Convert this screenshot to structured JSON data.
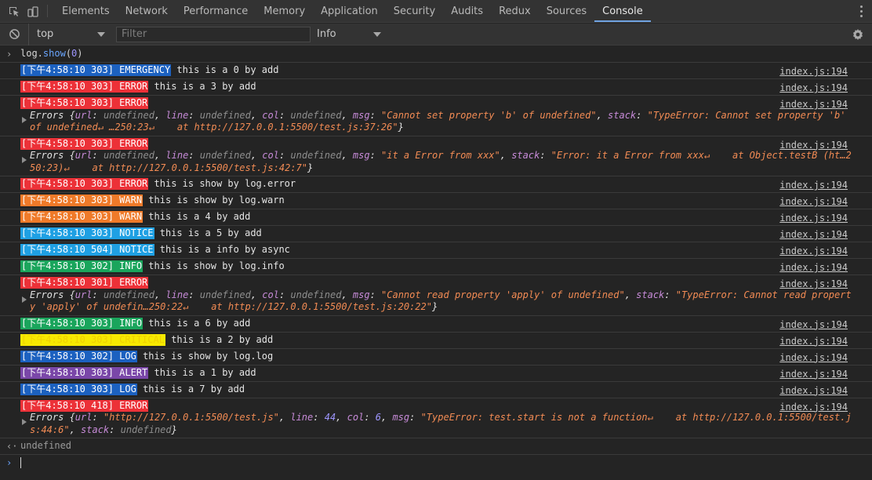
{
  "tabs": [
    "Elements",
    "Network",
    "Performance",
    "Memory",
    "Application",
    "Security",
    "Audits",
    "Redux",
    "Sources",
    "Console"
  ],
  "active_tab": "Console",
  "toolbar": {
    "context": "top",
    "filter_placeholder": "Filter",
    "level": "Info"
  },
  "input_command": {
    "prefix": "log.",
    "method": "show",
    "open": "(",
    "arg": "0",
    "close": ")"
  },
  "colors": {
    "EMERGENCY": "#1c61c0",
    "ERROR": "#ec3138",
    "WARN": "#ef7a29",
    "NOTICE": "#1fa0e3",
    "INFO": "#1aa55c",
    "CRITICAL": "#f7e900",
    "LOG": "#1c61c0",
    "ALERT": "#7a47a8"
  },
  "source": "index.js:194",
  "messages": [
    {
      "tag": "[下午4:58:10 303] EMERGENCY",
      "level": "EMERGENCY",
      "text": "this is a 0 by add"
    },
    {
      "tag": "[下午4:58:10 303] ERROR",
      "level": "ERROR",
      "text": "this is a 3 by add"
    },
    {
      "tag": "[下午4:58:10 303] ERROR",
      "level": "ERROR",
      "text": "",
      "obj": [
        [
          "t",
          "Errors {"
        ],
        [
          "k",
          "url"
        ],
        [
          "t",
          ": "
        ],
        [
          "u",
          "undefined"
        ],
        [
          "t",
          ", "
        ],
        [
          "k",
          "line"
        ],
        [
          "t",
          ": "
        ],
        [
          "u",
          "undefined"
        ],
        [
          "t",
          ", "
        ],
        [
          "k",
          "col"
        ],
        [
          "t",
          ": "
        ],
        [
          "u",
          "undefined"
        ],
        [
          "t",
          ", "
        ],
        [
          "k",
          "msg"
        ],
        [
          "t",
          ": "
        ],
        [
          "s",
          "\"Cannot set property 'b' of undefined\""
        ],
        [
          "t",
          ", "
        ],
        [
          "k",
          "stack"
        ],
        [
          "t",
          ": "
        ],
        [
          "s",
          "\"TypeError: Cannot set property 'b' of undefined↵ …250:23↵    at http://127.0.0.1:5500/test.js:37:26\""
        ],
        [
          "t",
          "}"
        ]
      ]
    },
    {
      "tag": "[下午4:58:10 303] ERROR",
      "level": "ERROR",
      "text": "",
      "obj": [
        [
          "t",
          "Errors {"
        ],
        [
          "k",
          "url"
        ],
        [
          "t",
          ": "
        ],
        [
          "u",
          "undefined"
        ],
        [
          "t",
          ", "
        ],
        [
          "k",
          "line"
        ],
        [
          "t",
          ": "
        ],
        [
          "u",
          "undefined"
        ],
        [
          "t",
          ", "
        ],
        [
          "k",
          "col"
        ],
        [
          "t",
          ": "
        ],
        [
          "u",
          "undefined"
        ],
        [
          "t",
          ", "
        ],
        [
          "k",
          "msg"
        ],
        [
          "t",
          ": "
        ],
        [
          "s",
          "\"it a Error from xxx\""
        ],
        [
          "t",
          ", "
        ],
        [
          "k",
          "stack"
        ],
        [
          "t",
          ": "
        ],
        [
          "s",
          "\"Error: it a Error from xxx↵    at Object.testB (ht…250:23)↵    at http://127.0.0.1:5500/test.js:42:7\""
        ],
        [
          "t",
          "}"
        ]
      ]
    },
    {
      "tag": "[下午4:58:10 303] ERROR",
      "level": "ERROR",
      "text": "this is show by log.error"
    },
    {
      "tag": "[下午4:58:10 303] WARN",
      "level": "WARN",
      "text": "this is show by log.warn"
    },
    {
      "tag": "[下午4:58:10 303] WARN",
      "level": "WARN",
      "text": "this is a 4 by add"
    },
    {
      "tag": "[下午4:58:10 303] NOTICE",
      "level": "NOTICE",
      "text": "this is a 5 by add"
    },
    {
      "tag": "[下午4:58:10 504] NOTICE",
      "level": "NOTICE",
      "text": "this is a info by async"
    },
    {
      "tag": "[下午4:58:10 302] INFO",
      "level": "INFO",
      "text": "this is show by log.info"
    },
    {
      "tag": "[下午4:58:10 301] ERROR",
      "level": "ERROR",
      "text": "",
      "obj": [
        [
          "t",
          "Errors {"
        ],
        [
          "k",
          "url"
        ],
        [
          "t",
          ": "
        ],
        [
          "u",
          "undefined"
        ],
        [
          "t",
          ", "
        ],
        [
          "k",
          "line"
        ],
        [
          "t",
          ": "
        ],
        [
          "u",
          "undefined"
        ],
        [
          "t",
          ", "
        ],
        [
          "k",
          "col"
        ],
        [
          "t",
          ": "
        ],
        [
          "u",
          "undefined"
        ],
        [
          "t",
          ", "
        ],
        [
          "k",
          "msg"
        ],
        [
          "t",
          ": "
        ],
        [
          "s",
          "\"Cannot read property 'apply' of undefined\""
        ],
        [
          "t",
          ", "
        ],
        [
          "k",
          "stack"
        ],
        [
          "t",
          ": "
        ],
        [
          "s",
          "\"TypeError: Cannot read property 'apply' of undefin…250:22↵    at http://127.0.0.1:5500/test.js:20:22\""
        ],
        [
          "t",
          "}"
        ]
      ]
    },
    {
      "tag": "[下午4:58:10 303] INFO",
      "level": "INFO",
      "text": "this is a 6 by add"
    },
    {
      "tag": "[下午4:58:10 303] CRITICAL",
      "level": "CRITICAL",
      "text": "this is a 2 by add"
    },
    {
      "tag": "[下午4:58:10 302] LOG",
      "level": "LOG",
      "text": "this is show by log.log"
    },
    {
      "tag": "[下午4:58:10 303] ALERT",
      "level": "ALERT",
      "text": "this is a 1 by add"
    },
    {
      "tag": "[下午4:58:10 303] LOG",
      "level": "LOG",
      "text": "this is a 7 by add"
    },
    {
      "tag": "[下午4:58:10 418] ERROR",
      "level": "ERROR",
      "text": "",
      "obj": [
        [
          "t",
          "Errors {"
        ],
        [
          "k",
          "url"
        ],
        [
          "t",
          ": "
        ],
        [
          "s",
          "\"http://127.0.0.1:5500/test.js\""
        ],
        [
          "t",
          ", "
        ],
        [
          "k",
          "line"
        ],
        [
          "t",
          ": "
        ],
        [
          "n",
          "44"
        ],
        [
          "t",
          ", "
        ],
        [
          "k",
          "col"
        ],
        [
          "t",
          ": "
        ],
        [
          "n",
          "6"
        ],
        [
          "t",
          ", "
        ],
        [
          "k",
          "msg"
        ],
        [
          "t",
          ": "
        ],
        [
          "s",
          "\"TypeError: test.start is not a function↵    at http://127.0.0.1:5500/test.js:44:6\""
        ],
        [
          "t",
          ", "
        ],
        [
          "k",
          "stack"
        ],
        [
          "t",
          ": "
        ],
        [
          "u",
          "undefined"
        ],
        [
          "t",
          "}"
        ]
      ]
    }
  ],
  "result": "undefined"
}
